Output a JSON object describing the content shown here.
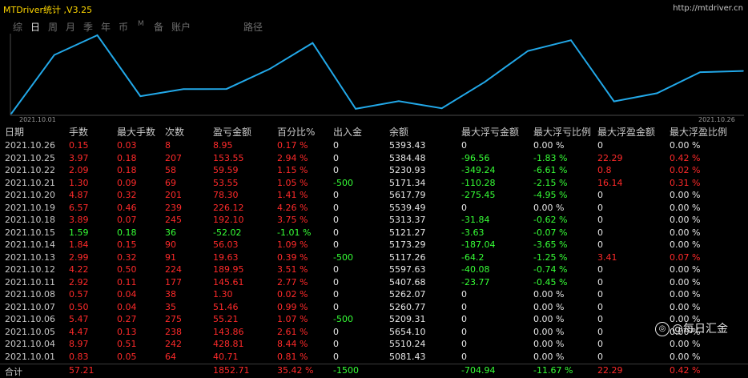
{
  "app": {
    "title": "MTDriver统计 ,V3.25",
    "url": "http://mtdriver.cn"
  },
  "nav": [
    "综",
    "日",
    "周",
    "月",
    "季",
    "年",
    "币",
    "M",
    "备",
    "账户",
    "路径"
  ],
  "nav_active": 1,
  "chart_data": {
    "type": "line",
    "x_start_label": "2021.10.01",
    "x_end_label": "2021.10.26",
    "x": [
      "2021.10.01",
      "2021.10.04",
      "2021.10.05",
      "2021.10.06",
      "2021.10.07",
      "2021.10.08",
      "2021.10.11",
      "2021.10.12",
      "2021.10.13",
      "2021.10.14",
      "2021.10.15",
      "2021.10.18",
      "2021.10.19",
      "2021.10.20",
      "2021.10.21",
      "2021.10.22",
      "2021.10.25",
      "2021.10.26"
    ],
    "values": [
      5081.43,
      5510.24,
      5654.1,
      5209.31,
      5260.77,
      5262.07,
      5407.68,
      5597.63,
      5117.26,
      5173.29,
      5121.27,
      5313.37,
      5539.49,
      5617.79,
      5171.34,
      5230.93,
      5384.48,
      5393.43
    ],
    "line_color": "#22a8e8"
  },
  "table": {
    "headers": [
      "日期",
      "手数",
      "最大手数",
      "次数",
      "盈亏金额",
      "百分比%",
      "出入金",
      "余额",
      "最大浮亏金额",
      "最大浮亏比例",
      "最大浮盈金额",
      "最大浮盈比例"
    ],
    "rows": [
      [
        "2021.10.26",
        "0.15",
        "0.03",
        "8",
        "8.95",
        "0.17 %",
        "0",
        "5393.43",
        "0",
        "0.00 %",
        "0",
        "0.00 %"
      ],
      [
        "2021.10.25",
        "3.97",
        "0.18",
        "207",
        "153.55",
        "2.94 %",
        "0",
        "5384.48",
        "-96.56",
        "-1.83 %",
        "22.29",
        "0.42 %"
      ],
      [
        "2021.10.22",
        "2.09",
        "0.18",
        "58",
        "59.59",
        "1.15 %",
        "0",
        "5230.93",
        "-349.24",
        "-6.61 %",
        "0.8",
        "0.02 %"
      ],
      [
        "2021.10.21",
        "1.30",
        "0.09",
        "69",
        "53.55",
        "1.05 %",
        "-500",
        "5171.34",
        "-110.28",
        "-2.15 %",
        "16.14",
        "0.31 %"
      ],
      [
        "2021.10.20",
        "4.87",
        "0.32",
        "201",
        "78.30",
        "1.41 %",
        "0",
        "5617.79",
        "-275.45",
        "-4.95 %",
        "0",
        "0.00 %"
      ],
      [
        "2021.10.19",
        "6.57",
        "0.46",
        "239",
        "226.12",
        "4.26 %",
        "0",
        "5539.49",
        "0",
        "0.00 %",
        "0",
        "0.00 %"
      ],
      [
        "2021.10.18",
        "3.89",
        "0.07",
        "245",
        "192.10",
        "3.75 %",
        "0",
        "5313.37",
        "-31.84",
        "-0.62 %",
        "0",
        "0.00 %"
      ],
      [
        "2021.10.15",
        "1.59",
        "0.18",
        "36",
        "-52.02",
        "-1.01 %",
        "0",
        "5121.27",
        "-3.63",
        "-0.07 %",
        "0",
        "0.00 %"
      ],
      [
        "2021.10.14",
        "1.84",
        "0.15",
        "90",
        "56.03",
        "1.09 %",
        "0",
        "5173.29",
        "-187.04",
        "-3.65 %",
        "0",
        "0.00 %"
      ],
      [
        "2021.10.13",
        "2.99",
        "0.32",
        "91",
        "19.63",
        "0.39 %",
        "-500",
        "5117.26",
        "-64.2",
        "-1.25 %",
        "3.41",
        "0.07 %"
      ],
      [
        "2021.10.12",
        "4.22",
        "0.50",
        "224",
        "189.95",
        "3.51 %",
        "0",
        "5597.63",
        "-40.08",
        "-0.74 %",
        "0",
        "0.00 %"
      ],
      [
        "2021.10.11",
        "2.92",
        "0.11",
        "177",
        "145.61",
        "2.77 %",
        "0",
        "5407.68",
        "-23.77",
        "-0.45 %",
        "0",
        "0.00 %"
      ],
      [
        "2021.10.08",
        "0.57",
        "0.04",
        "38",
        "1.30",
        "0.02 %",
        "0",
        "5262.07",
        "0",
        "0.00 %",
        "0",
        "0.00 %"
      ],
      [
        "2021.10.07",
        "0.50",
        "0.04",
        "35",
        "51.46",
        "0.99 %",
        "0",
        "5260.77",
        "0",
        "0.00 %",
        "0",
        "0.00 %"
      ],
      [
        "2021.10.06",
        "5.47",
        "0.27",
        "275",
        "55.21",
        "1.07 %",
        "-500",
        "5209.31",
        "0",
        "0.00 %",
        "0",
        "0.00 %"
      ],
      [
        "2021.10.05",
        "4.47",
        "0.13",
        "238",
        "143.86",
        "2.61 %",
        "0",
        "5654.10",
        "0",
        "0.00 %",
        "0",
        "0.00 %"
      ],
      [
        "2021.10.04",
        "8.97",
        "0.51",
        "242",
        "428.81",
        "8.44 %",
        "0",
        "5510.24",
        "0",
        "0.00 %",
        "0",
        "0.00 %"
      ],
      [
        "2021.10.01",
        "0.83",
        "0.05",
        "64",
        "40.71",
        "0.81 %",
        "0",
        "5081.43",
        "0",
        "0.00 %",
        "0",
        "0.00 %"
      ]
    ],
    "total": [
      "合计",
      "57.21",
      "",
      "",
      "1852.71",
      "35.42 %",
      "-1500",
      "",
      "-704.94",
      "-11.67 %",
      "22.29",
      "0.42 %"
    ]
  },
  "watermark": {
    "text": "@每日汇金",
    "icon": "weibo-icon"
  },
  "colors": {
    "positive": "#ff2a2a",
    "negative": "#36ff36",
    "neutral": "#e6e6e6",
    "accent": "#ffd700"
  }
}
